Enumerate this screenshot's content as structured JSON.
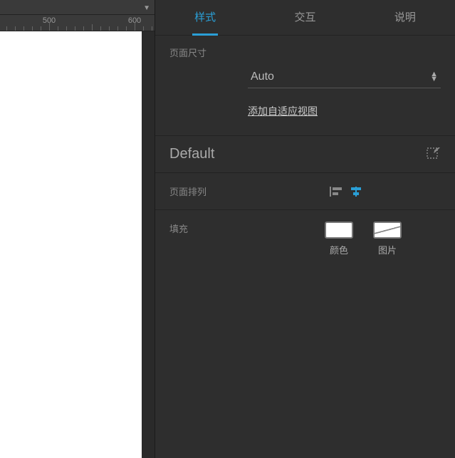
{
  "ruler": {
    "marks": [
      "500",
      "600"
    ]
  },
  "tabs": {
    "style": "样式",
    "interaction": "交互",
    "notes": "说明"
  },
  "page_size": {
    "label": "页面尺寸",
    "value": "Auto",
    "adaptive_link": "添加自适应视图"
  },
  "default_label": "Default",
  "page_align": {
    "label": "页面排列"
  },
  "fill": {
    "label": "填充",
    "color_label": "颜色",
    "image_label": "图片"
  }
}
